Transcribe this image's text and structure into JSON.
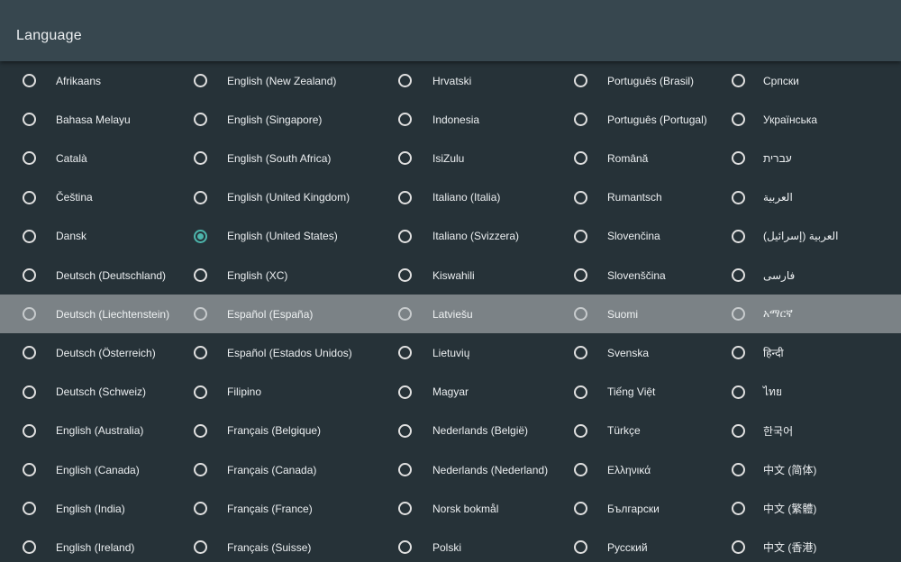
{
  "header": {
    "title": "Language"
  },
  "colors": {
    "background": "#263238",
    "header": "#37474f",
    "highlight": "#7b8286",
    "accent": "#4db6ac"
  },
  "selected_language": "English (United States)",
  "focused_language": "Deutsch (Liechtenstein)",
  "languages": {
    "rows": [
      [
        "Afrikaans",
        "English (New Zealand)",
        "Hrvatski",
        "Português (Brasil)",
        "Српски"
      ],
      [
        "Bahasa Melayu",
        "English (Singapore)",
        "Indonesia",
        "Português (Portugal)",
        "Українська"
      ],
      [
        "Català",
        "English (South Africa)",
        "IsiZulu",
        "Română",
        "עברית"
      ],
      [
        "Čeština",
        "English (United Kingdom)",
        "Italiano (Italia)",
        "Rumantsch",
        "العربية"
      ],
      [
        "Dansk",
        "English (United States)",
        "Italiano (Svizzera)",
        "Slovenčina",
        "العربية (إسرائيل)"
      ],
      [
        "Deutsch (Deutschland)",
        "English (XC)",
        "Kiswahili",
        "Slovenščina",
        "فارسی"
      ],
      [
        "Deutsch (Liechtenstein)",
        "Español (España)",
        "Latviešu",
        "Suomi",
        "አማርኛ"
      ],
      [
        "Deutsch (Österreich)",
        "Español (Estados Unidos)",
        "Lietuvių",
        "Svenska",
        "हिन्दी"
      ],
      [
        "Deutsch (Schweiz)",
        "Filipino",
        "Magyar",
        "Tiếng Việt",
        "ไทย"
      ],
      [
        "English (Australia)",
        "Français (Belgique)",
        "Nederlands (België)",
        "Türkçe",
        "한국어"
      ],
      [
        "English (Canada)",
        "Français (Canada)",
        "Nederlands (Nederland)",
        "Ελληνικά",
        "中文 (简体)"
      ],
      [
        "English (India)",
        "Français (France)",
        "Norsk bokmål",
        "Български",
        "中文 (繁體)"
      ],
      [
        "English (Ireland)",
        "Français (Suisse)",
        "Polski",
        "Русский",
        "中文 (香港)"
      ]
    ]
  }
}
